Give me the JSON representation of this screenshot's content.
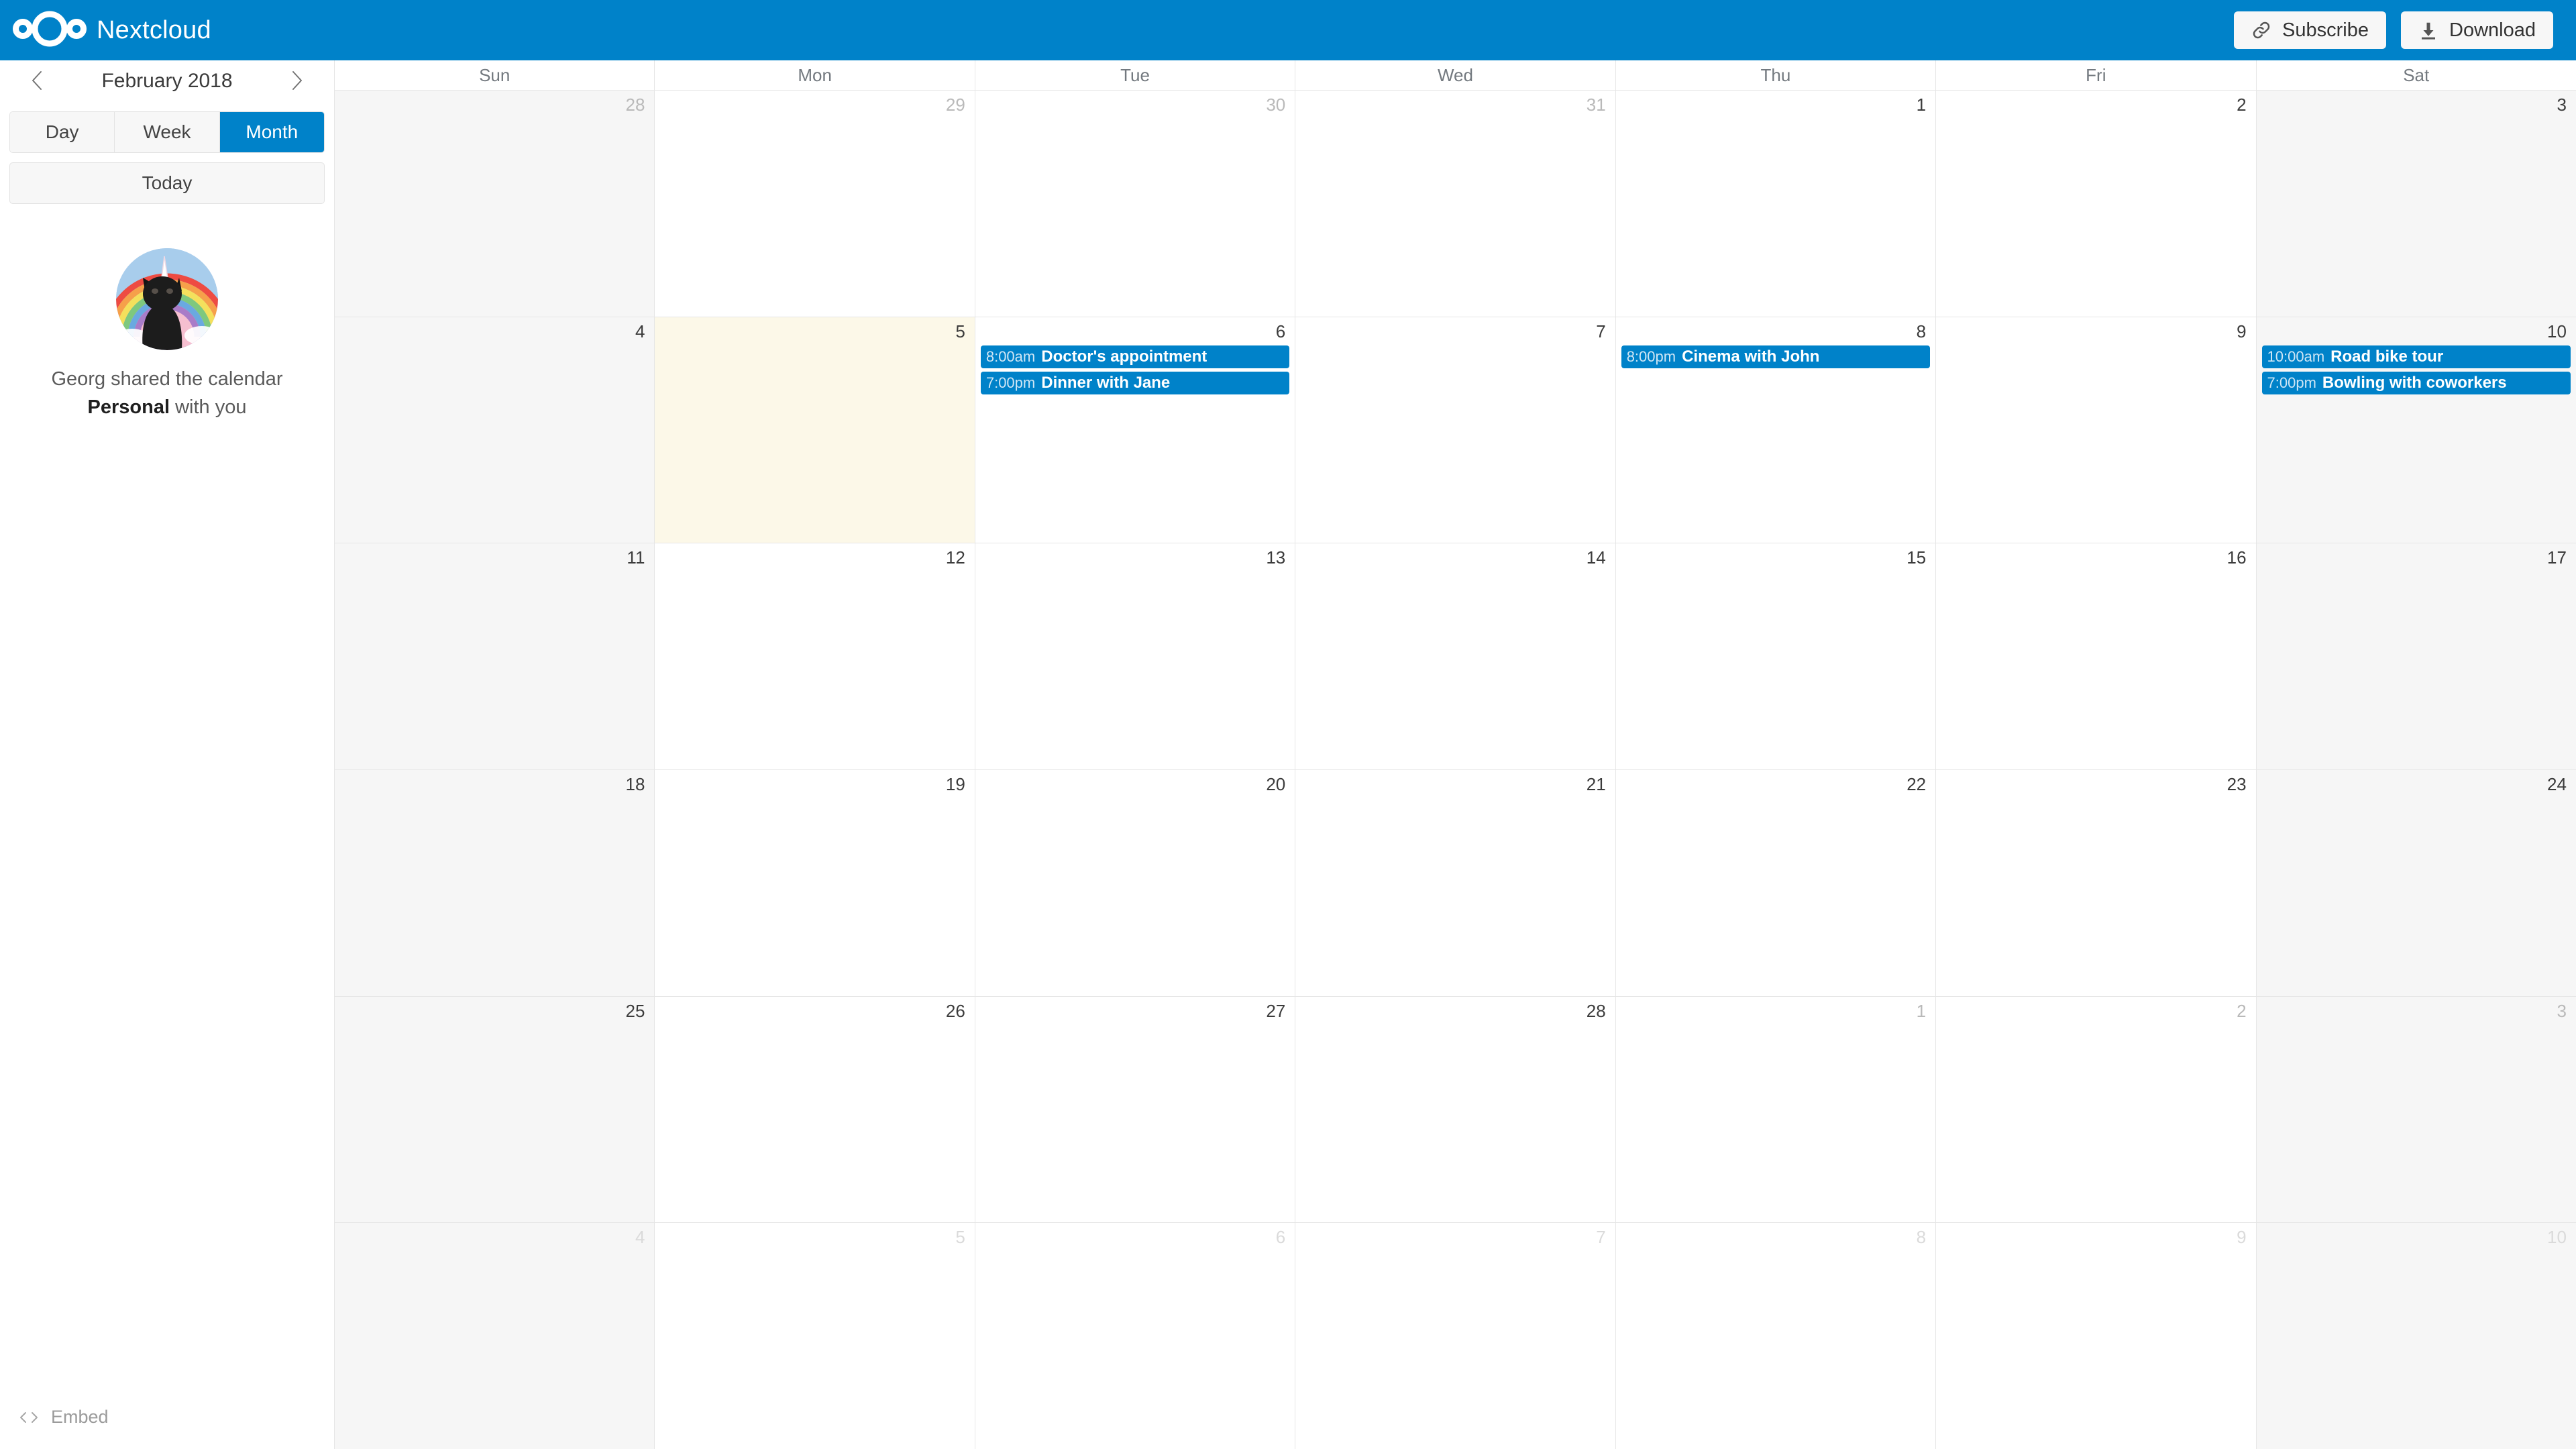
{
  "header": {
    "brand_name": "Nextcloud",
    "logo_icon": "nextcloud-logo-icon",
    "subscribe_label": "Subscribe",
    "subscribe_icon": "link-icon",
    "download_label": "Download",
    "download_icon": "download-arrow-icon"
  },
  "sidebar": {
    "prev_icon": "chevron-left-icon",
    "next_icon": "chevron-right-icon",
    "current_period": "February 2018",
    "views": [
      {
        "label": "Day",
        "active": false
      },
      {
        "label": "Week",
        "active": false
      },
      {
        "label": "Month",
        "active": true
      }
    ],
    "today_label": "Today",
    "avatar_icon": "unicorn-cat-avatar",
    "share_prefix": "Georg shared the calendar",
    "share_calendar_name": "Personal",
    "share_suffix": "with you",
    "embed_label": "Embed",
    "embed_icon": "code-brackets-icon"
  },
  "calendar": {
    "weekdays": [
      "Sun",
      "Mon",
      "Tue",
      "Wed",
      "Thu",
      "Fri",
      "Sat"
    ],
    "accent_color": "#0082c9",
    "today_color": "#fcf8e8",
    "weekend_color": "#f6f6f6",
    "weeks": [
      {
        "days": [
          {
            "num": "28",
            "month": "other",
            "weekend": true,
            "today": false,
            "events": []
          },
          {
            "num": "29",
            "month": "other",
            "weekend": false,
            "today": false,
            "events": []
          },
          {
            "num": "30",
            "month": "other",
            "weekend": false,
            "today": false,
            "events": []
          },
          {
            "num": "31",
            "month": "other",
            "weekend": false,
            "today": false,
            "events": []
          },
          {
            "num": "1",
            "month": "current",
            "weekend": false,
            "today": false,
            "events": []
          },
          {
            "num": "2",
            "month": "current",
            "weekend": false,
            "today": false,
            "events": []
          },
          {
            "num": "3",
            "month": "current",
            "weekend": true,
            "today": false,
            "events": []
          }
        ]
      },
      {
        "days": [
          {
            "num": "4",
            "month": "current",
            "weekend": true,
            "today": false,
            "events": []
          },
          {
            "num": "5",
            "month": "current",
            "weekend": false,
            "today": true,
            "events": []
          },
          {
            "num": "6",
            "month": "current",
            "weekend": false,
            "today": false,
            "events": [
              {
                "time": "8:00am",
                "title": "Doctor's appointment"
              },
              {
                "time": "7:00pm",
                "title": "Dinner with Jane"
              }
            ]
          },
          {
            "num": "7",
            "month": "current",
            "weekend": false,
            "today": false,
            "events": []
          },
          {
            "num": "8",
            "month": "current",
            "weekend": false,
            "today": false,
            "events": [
              {
                "time": "8:00pm",
                "title": "Cinema with John"
              }
            ]
          },
          {
            "num": "9",
            "month": "current",
            "weekend": false,
            "today": false,
            "events": []
          },
          {
            "num": "10",
            "month": "current",
            "weekend": true,
            "today": false,
            "events": [
              {
                "time": "10:00am",
                "title": "Road bike tour"
              },
              {
                "time": "7:00pm",
                "title": "Bowling with coworkers"
              }
            ]
          }
        ]
      },
      {
        "days": [
          {
            "num": "11",
            "month": "current",
            "weekend": true,
            "today": false,
            "events": []
          },
          {
            "num": "12",
            "month": "current",
            "weekend": false,
            "today": false,
            "events": []
          },
          {
            "num": "13",
            "month": "current",
            "weekend": false,
            "today": false,
            "events": []
          },
          {
            "num": "14",
            "month": "current",
            "weekend": false,
            "today": false,
            "events": []
          },
          {
            "num": "15",
            "month": "current",
            "weekend": false,
            "today": false,
            "events": []
          },
          {
            "num": "16",
            "month": "current",
            "weekend": false,
            "today": false,
            "events": []
          },
          {
            "num": "17",
            "month": "current",
            "weekend": true,
            "today": false,
            "events": []
          }
        ]
      },
      {
        "days": [
          {
            "num": "18",
            "month": "current",
            "weekend": true,
            "today": false,
            "events": []
          },
          {
            "num": "19",
            "month": "current",
            "weekend": false,
            "today": false,
            "events": []
          },
          {
            "num": "20",
            "month": "current",
            "weekend": false,
            "today": false,
            "events": []
          },
          {
            "num": "21",
            "month": "current",
            "weekend": false,
            "today": false,
            "events": []
          },
          {
            "num": "22",
            "month": "current",
            "weekend": false,
            "today": false,
            "events": []
          },
          {
            "num": "23",
            "month": "current",
            "weekend": false,
            "today": false,
            "events": []
          },
          {
            "num": "24",
            "month": "current",
            "weekend": true,
            "today": false,
            "events": []
          }
        ]
      },
      {
        "days": [
          {
            "num": "25",
            "month": "current",
            "weekend": true,
            "today": false,
            "events": []
          },
          {
            "num": "26",
            "month": "current",
            "weekend": false,
            "today": false,
            "events": []
          },
          {
            "num": "27",
            "month": "current",
            "weekend": false,
            "today": false,
            "events": []
          },
          {
            "num": "28",
            "month": "current",
            "weekend": false,
            "today": false,
            "events": []
          },
          {
            "num": "1",
            "month": "other",
            "weekend": false,
            "today": false,
            "events": []
          },
          {
            "num": "2",
            "month": "other",
            "weekend": false,
            "today": false,
            "events": []
          },
          {
            "num": "3",
            "month": "other",
            "weekend": true,
            "today": false,
            "events": []
          }
        ]
      },
      {
        "days": [
          {
            "num": "4",
            "month": "faded",
            "weekend": true,
            "today": false,
            "events": []
          },
          {
            "num": "5",
            "month": "faded",
            "weekend": false,
            "today": false,
            "events": []
          },
          {
            "num": "6",
            "month": "faded",
            "weekend": false,
            "today": false,
            "events": []
          },
          {
            "num": "7",
            "month": "faded",
            "weekend": false,
            "today": false,
            "events": []
          },
          {
            "num": "8",
            "month": "faded",
            "weekend": false,
            "today": false,
            "events": []
          },
          {
            "num": "9",
            "month": "faded",
            "weekend": false,
            "today": false,
            "events": []
          },
          {
            "num": "10",
            "month": "faded",
            "weekend": true,
            "today": false,
            "events": []
          }
        ]
      }
    ]
  }
}
